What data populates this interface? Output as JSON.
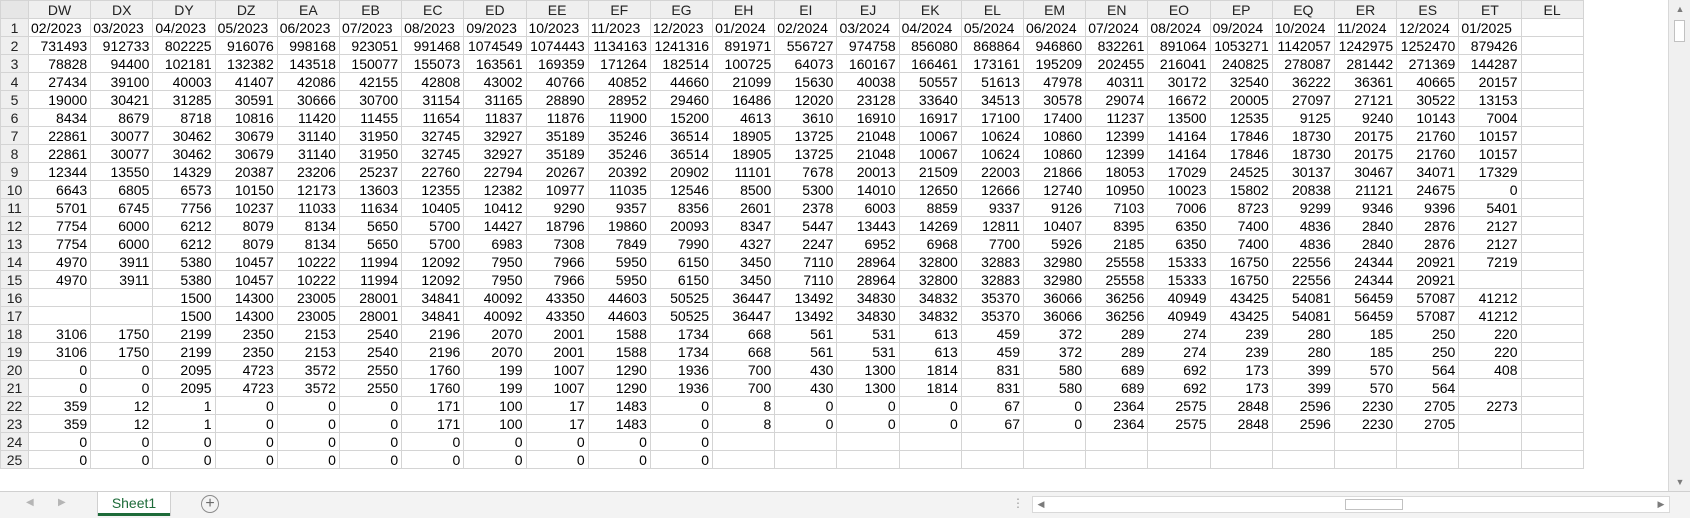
{
  "sheet": {
    "columns": [
      "DW",
      "DX",
      "DY",
      "DZ",
      "EA",
      "EB",
      "EC",
      "ED",
      "EE",
      "EF",
      "EG",
      "EH",
      "EI",
      "EJ",
      "EK",
      "EL",
      "EM",
      "EN",
      "EO",
      "EP",
      "EQ",
      "ER",
      "ES",
      "ET",
      "EL"
    ],
    "rows": [
      {
        "n": "1",
        "cells": [
          "02/2023",
          "03/2023",
          "04/2023",
          "05/2023",
          "06/2023",
          "07/2023",
          "08/2023",
          "09/2023",
          "10/2023",
          "11/2023",
          "12/2023",
          "01/2024",
          "02/2024",
          "03/2024",
          "04/2024",
          "05/2024",
          "06/2024",
          "07/2024",
          "08/2024",
          "09/2024",
          "10/2024",
          "11/2024",
          "12/2024",
          "01/2025",
          ""
        ]
      },
      {
        "n": "2",
        "cells": [
          "731493",
          "912733",
          "802225",
          "916076",
          "998168",
          "923051",
          "991468",
          "1074549",
          "1074443",
          "1134163",
          "1241316",
          "891971",
          "556727",
          "974758",
          "856080",
          "868864",
          "946860",
          "832261",
          "891064",
          "1053271",
          "1142057",
          "1242975",
          "1252470",
          "879426",
          ""
        ]
      },
      {
        "n": "3",
        "cells": [
          "78828",
          "94400",
          "102181",
          "132382",
          "143518",
          "150077",
          "155073",
          "163561",
          "169359",
          "171264",
          "182514",
          "100725",
          "64073",
          "160167",
          "166461",
          "173161",
          "195209",
          "202455",
          "216041",
          "240825",
          "278087",
          "281442",
          "271369",
          "144287",
          ""
        ]
      },
      {
        "n": "4",
        "cells": [
          "27434",
          "39100",
          "40003",
          "41407",
          "42086",
          "42155",
          "42808",
          "43002",
          "40766",
          "40852",
          "44660",
          "21099",
          "15630",
          "40038",
          "50557",
          "51613",
          "47978",
          "40311",
          "30172",
          "32540",
          "36222",
          "36361",
          "40665",
          "20157",
          ""
        ]
      },
      {
        "n": "5",
        "cells": [
          "19000",
          "30421",
          "31285",
          "30591",
          "30666",
          "30700",
          "31154",
          "31165",
          "28890",
          "28952",
          "29460",
          "16486",
          "12020",
          "23128",
          "33640",
          "34513",
          "30578",
          "29074",
          "16672",
          "20005",
          "27097",
          "27121",
          "30522",
          "13153",
          ""
        ]
      },
      {
        "n": "6",
        "cells": [
          "8434",
          "8679",
          "8718",
          "10816",
          "11420",
          "11455",
          "11654",
          "11837",
          "11876",
          "11900",
          "15200",
          "4613",
          "3610",
          "16910",
          "16917",
          "17100",
          "17400",
          "11237",
          "13500",
          "12535",
          "9125",
          "9240",
          "10143",
          "7004",
          ""
        ]
      },
      {
        "n": "7",
        "cells": [
          "22861",
          "30077",
          "30462",
          "30679",
          "31140",
          "31950",
          "32745",
          "32927",
          "35189",
          "35246",
          "36514",
          "18905",
          "13725",
          "21048",
          "10067",
          "10624",
          "10860",
          "12399",
          "14164",
          "17846",
          "18730",
          "20175",
          "21760",
          "10157",
          ""
        ]
      },
      {
        "n": "8",
        "cells": [
          "22861",
          "30077",
          "30462",
          "30679",
          "31140",
          "31950",
          "32745",
          "32927",
          "35189",
          "35246",
          "36514",
          "18905",
          "13725",
          "21048",
          "10067",
          "10624",
          "10860",
          "12399",
          "14164",
          "17846",
          "18730",
          "20175",
          "21760",
          "10157",
          ""
        ]
      },
      {
        "n": "9",
        "cells": [
          "12344",
          "13550",
          "14329",
          "20387",
          "23206",
          "25237",
          "22760",
          "22794",
          "20267",
          "20392",
          "20902",
          "11101",
          "7678",
          "20013",
          "21509",
          "22003",
          "21866",
          "18053",
          "17029",
          "24525",
          "30137",
          "30467",
          "34071",
          "17329",
          ""
        ]
      },
      {
        "n": "10",
        "cells": [
          "6643",
          "6805",
          "6573",
          "10150",
          "12173",
          "13603",
          "12355",
          "12382",
          "10977",
          "11035",
          "12546",
          "8500",
          "5300",
          "14010",
          "12650",
          "12666",
          "12740",
          "10950",
          "10023",
          "15802",
          "20838",
          "21121",
          "24675",
          "0",
          ""
        ]
      },
      {
        "n": "11",
        "cells": [
          "5701",
          "6745",
          "7756",
          "10237",
          "11033",
          "11634",
          "10405",
          "10412",
          "9290",
          "9357",
          "8356",
          "2601",
          "2378",
          "6003",
          "8859",
          "9337",
          "9126",
          "7103",
          "7006",
          "8723",
          "9299",
          "9346",
          "9396",
          "5401",
          ""
        ]
      },
      {
        "n": "12",
        "cells": [
          "7754",
          "6000",
          "6212",
          "8079",
          "8134",
          "5650",
          "5700",
          "14427",
          "18796",
          "19860",
          "20093",
          "8347",
          "5447",
          "13443",
          "14269",
          "12811",
          "10407",
          "8395",
          "6350",
          "7400",
          "4836",
          "2840",
          "2876",
          "2127",
          ""
        ]
      },
      {
        "n": "13",
        "cells": [
          "7754",
          "6000",
          "6212",
          "8079",
          "8134",
          "5650",
          "5700",
          "6983",
          "7308",
          "7849",
          "7990",
          "4327",
          "2247",
          "6952",
          "6968",
          "7700",
          "5926",
          "2185",
          "6350",
          "7400",
          "4836",
          "2840",
          "2876",
          "2127",
          ""
        ]
      },
      {
        "n": "14",
        "cells": [
          "4970",
          "3911",
          "5380",
          "10457",
          "10222",
          "11994",
          "12092",
          "7950",
          "7966",
          "5950",
          "6150",
          "3450",
          "7110",
          "28964",
          "32800",
          "32883",
          "32980",
          "25558",
          "15333",
          "16750",
          "22556",
          "24344",
          "20921",
          "7219",
          ""
        ]
      },
      {
        "n": "15",
        "cells": [
          "4970",
          "3911",
          "5380",
          "10457",
          "10222",
          "11994",
          "12092",
          "7950",
          "7966",
          "5950",
          "6150",
          "3450",
          "7110",
          "28964",
          "32800",
          "32883",
          "32980",
          "25558",
          "15333",
          "16750",
          "22556",
          "24344",
          "20921",
          "",
          ""
        ]
      },
      {
        "n": "16",
        "cells": [
          "",
          "",
          "1500",
          "14300",
          "23005",
          "28001",
          "34841",
          "40092",
          "43350",
          "44603",
          "50525",
          "36447",
          "13492",
          "34830",
          "34832",
          "35370",
          "36066",
          "36256",
          "40949",
          "43425",
          "54081",
          "56459",
          "57087",
          "41212",
          ""
        ]
      },
      {
        "n": "17",
        "cells": [
          "",
          "",
          "1500",
          "14300",
          "23005",
          "28001",
          "34841",
          "40092",
          "43350",
          "44603",
          "50525",
          "36447",
          "13492",
          "34830",
          "34832",
          "35370",
          "36066",
          "36256",
          "40949",
          "43425",
          "54081",
          "56459",
          "57087",
          "41212",
          ""
        ]
      },
      {
        "n": "18",
        "cells": [
          "3106",
          "1750",
          "2199",
          "2350",
          "2153",
          "2540",
          "2196",
          "2070",
          "2001",
          "1588",
          "1734",
          "668",
          "561",
          "531",
          "613",
          "459",
          "372",
          "289",
          "274",
          "239",
          "280",
          "185",
          "250",
          "220",
          ""
        ]
      },
      {
        "n": "19",
        "cells": [
          "3106",
          "1750",
          "2199",
          "2350",
          "2153",
          "2540",
          "2196",
          "2070",
          "2001",
          "1588",
          "1734",
          "668",
          "561",
          "531",
          "613",
          "459",
          "372",
          "289",
          "274",
          "239",
          "280",
          "185",
          "250",
          "220",
          ""
        ]
      },
      {
        "n": "20",
        "cells": [
          "0",
          "0",
          "2095",
          "4723",
          "3572",
          "2550",
          "1760",
          "199",
          "1007",
          "1290",
          "1936",
          "700",
          "430",
          "1300",
          "1814",
          "831",
          "580",
          "689",
          "692",
          "173",
          "399",
          "570",
          "564",
          "408",
          ""
        ]
      },
      {
        "n": "21",
        "cells": [
          "0",
          "0",
          "2095",
          "4723",
          "3572",
          "2550",
          "1760",
          "199",
          "1007",
          "1290",
          "1936",
          "700",
          "430",
          "1300",
          "1814",
          "831",
          "580",
          "689",
          "692",
          "173",
          "399",
          "570",
          "564",
          "",
          ""
        ]
      },
      {
        "n": "22",
        "cells": [
          "359",
          "12",
          "1",
          "0",
          "0",
          "0",
          "171",
          "100",
          "17",
          "1483",
          "0",
          "8",
          "0",
          "0",
          "0",
          "67",
          "0",
          "2364",
          "2575",
          "2848",
          "2596",
          "2230",
          "2705",
          "2273",
          ""
        ]
      },
      {
        "n": "23",
        "cells": [
          "359",
          "12",
          "1",
          "0",
          "0",
          "0",
          "171",
          "100",
          "17",
          "1483",
          "0",
          "8",
          "0",
          "0",
          "0",
          "67",
          "0",
          "2364",
          "2575",
          "2848",
          "2596",
          "2230",
          "2705",
          "",
          ""
        ]
      },
      {
        "n": "24",
        "cells": [
          "0",
          "0",
          "0",
          "0",
          "0",
          "0",
          "0",
          "0",
          "0",
          "0",
          "0",
          "",
          "",
          "",
          "",
          "",
          "",
          "",
          "",
          "",
          "",
          "",
          "",
          "",
          ""
        ]
      },
      {
        "n": "25",
        "cells": [
          "0",
          "0",
          "0",
          "0",
          "0",
          "0",
          "0",
          "0",
          "0",
          "0",
          "0",
          "",
          "",
          "",
          "",
          "",
          "",
          "",
          "",
          "",
          "",
          "",
          "",
          "",
          ""
        ]
      }
    ]
  },
  "tabs": {
    "active": "Sheet1",
    "add_label": "+"
  },
  "icons": {
    "scroll_up": "▲",
    "scroll_down": "▼",
    "scroll_left": "◀",
    "scroll_right": "▶",
    "sheet_prev": "◀",
    "sheet_next": "▶",
    "split_handle": "⋮"
  },
  "colors": {
    "tab_accent": "#1d6b39",
    "header_bg": "#efefef",
    "gridline": "#d4d4d4"
  }
}
